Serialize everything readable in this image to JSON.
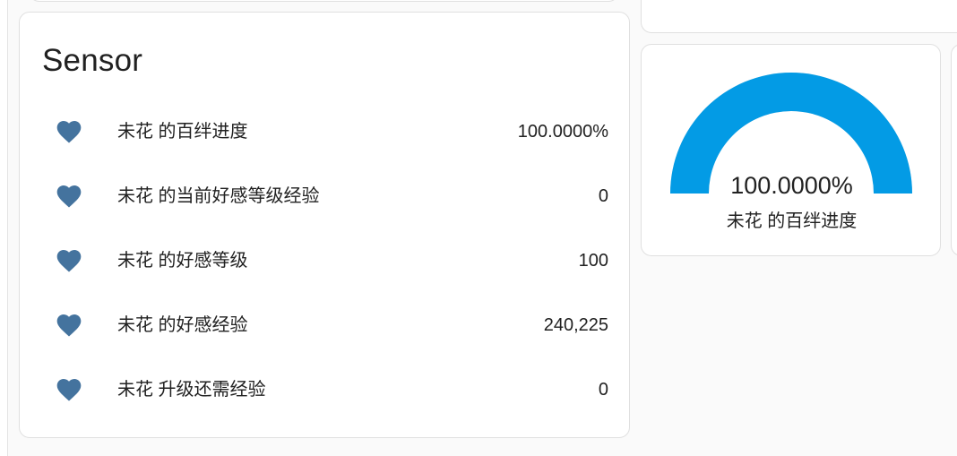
{
  "sensor_card": {
    "title": "Sensor",
    "entities": [
      {
        "icon": "heart-icon",
        "name": "未花 的百绊进度",
        "value": "100.0000%"
      },
      {
        "icon": "heart-icon",
        "name": "未花 的当前好感等级经验",
        "value": "0"
      },
      {
        "icon": "heart-icon",
        "name": "未花 的好感等级",
        "value": "100"
      },
      {
        "icon": "heart-icon",
        "name": "未花 的好感经验",
        "value": "240,225"
      },
      {
        "icon": "heart-icon",
        "name": "未花 升级还需经验",
        "value": "0"
      }
    ]
  },
  "gauge_card": {
    "value_text": "100.0000%",
    "level": 1.0,
    "name": "未花 的百绊进度"
  },
  "colors": {
    "heart_icon": "#44739e",
    "gauge_fill": "#039be5",
    "card_background": "#ffffff",
    "page_background": "#fafafa"
  }
}
